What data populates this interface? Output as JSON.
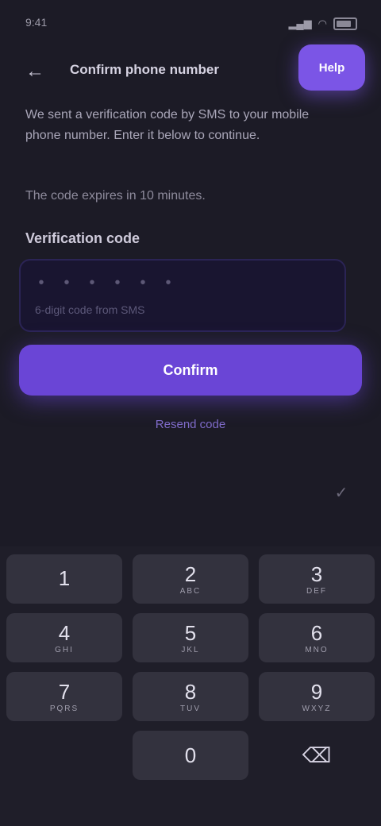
{
  "status": {
    "time": "9:41",
    "battery": "100%"
  },
  "header": {
    "back_icon": "arrow-left-icon",
    "title": "Confirm phone number",
    "action_label": "Help"
  },
  "content": {
    "description": "We sent a verification code by SMS to your mobile phone number. Enter it below to continue.",
    "description2": "The code expires in 10 minutes.",
    "field_label": "Verification code",
    "code_value": "",
    "code_placeholder": "• • • • • •",
    "code_hint": "6-digit code from SMS"
  },
  "actions": {
    "primary_label": "Confirm",
    "secondary_label": "Resend code"
  },
  "keyboard": {
    "toolbar_text": "",
    "done_icon": "check-icon",
    "keys": [
      {
        "num": "1",
        "sub": ""
      },
      {
        "num": "2",
        "sub": "ABC"
      },
      {
        "num": "3",
        "sub": "DEF"
      },
      {
        "num": "4",
        "sub": "GHI"
      },
      {
        "num": "5",
        "sub": "JKL"
      },
      {
        "num": "6",
        "sub": "MNO"
      },
      {
        "num": "7",
        "sub": "PQRS"
      },
      {
        "num": "8",
        "sub": "TUV"
      },
      {
        "num": "9",
        "sub": "WXYZ"
      },
      {
        "num": "0",
        "sub": ""
      }
    ],
    "delete_icon": "backspace-icon"
  },
  "colors": {
    "accent": "#6a45d6",
    "accent_light": "#7b55e6",
    "background": "#1c1b26"
  }
}
